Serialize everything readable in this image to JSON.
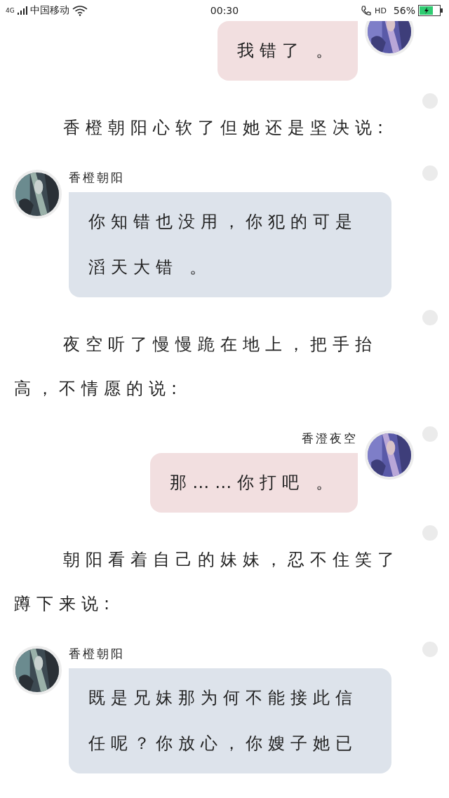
{
  "status_bar": {
    "network": "4G",
    "carrier": "中国移动",
    "time": "00:30",
    "call_mode": "HD",
    "battery": "56%"
  },
  "items": [
    {
      "kind": "outgoing",
      "clipped": true,
      "text": "我错了 。"
    },
    {
      "kind": "narration",
      "text": "香橙朝阳心软了但她还是坚决说:"
    },
    {
      "kind": "incoming",
      "name": "香橙朝阳",
      "text": "你知错也没用，你犯的可是滔天大错 。"
    },
    {
      "kind": "narration",
      "text": "夜空听了慢慢跪在地上，把手抬高，不情愿的说:"
    },
    {
      "kind": "outgoing",
      "name": "香澄夜空",
      "text": "那……你打吧 。"
    },
    {
      "kind": "narration",
      "text": "朝阳看着自己的妹妹，忍不住笑了蹲下来说:"
    },
    {
      "kind": "incoming",
      "name": "香橙朝阳",
      "text": "既是兄妹那为何不能接此信任呢？你放心，你嫂子她已"
    }
  ]
}
